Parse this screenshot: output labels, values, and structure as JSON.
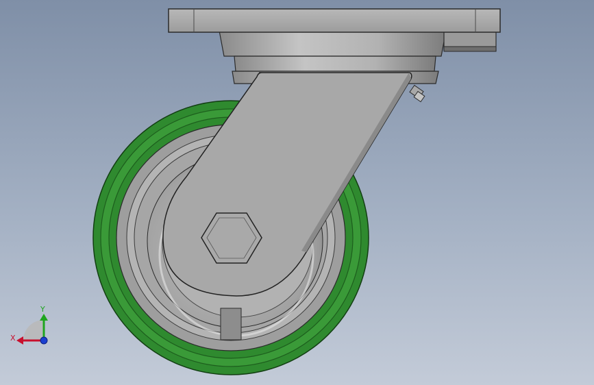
{
  "viewport": {
    "model_name": "swivel-caster-assembly",
    "colors": {
      "background_top": "#7f8fa7",
      "background_bottom": "#c3cbd8",
      "tread_green": "#2f8a2f",
      "tread_dark": "#1d5e1d",
      "metal_gray": "#a9a9a9",
      "edge_dark": "#2a2a2a"
    }
  },
  "triad": {
    "x_label": "X",
    "y_label": "Y",
    "x_color": "#c8102e",
    "y_color": "#1ea51e",
    "z_color": "#1a3fd0"
  }
}
